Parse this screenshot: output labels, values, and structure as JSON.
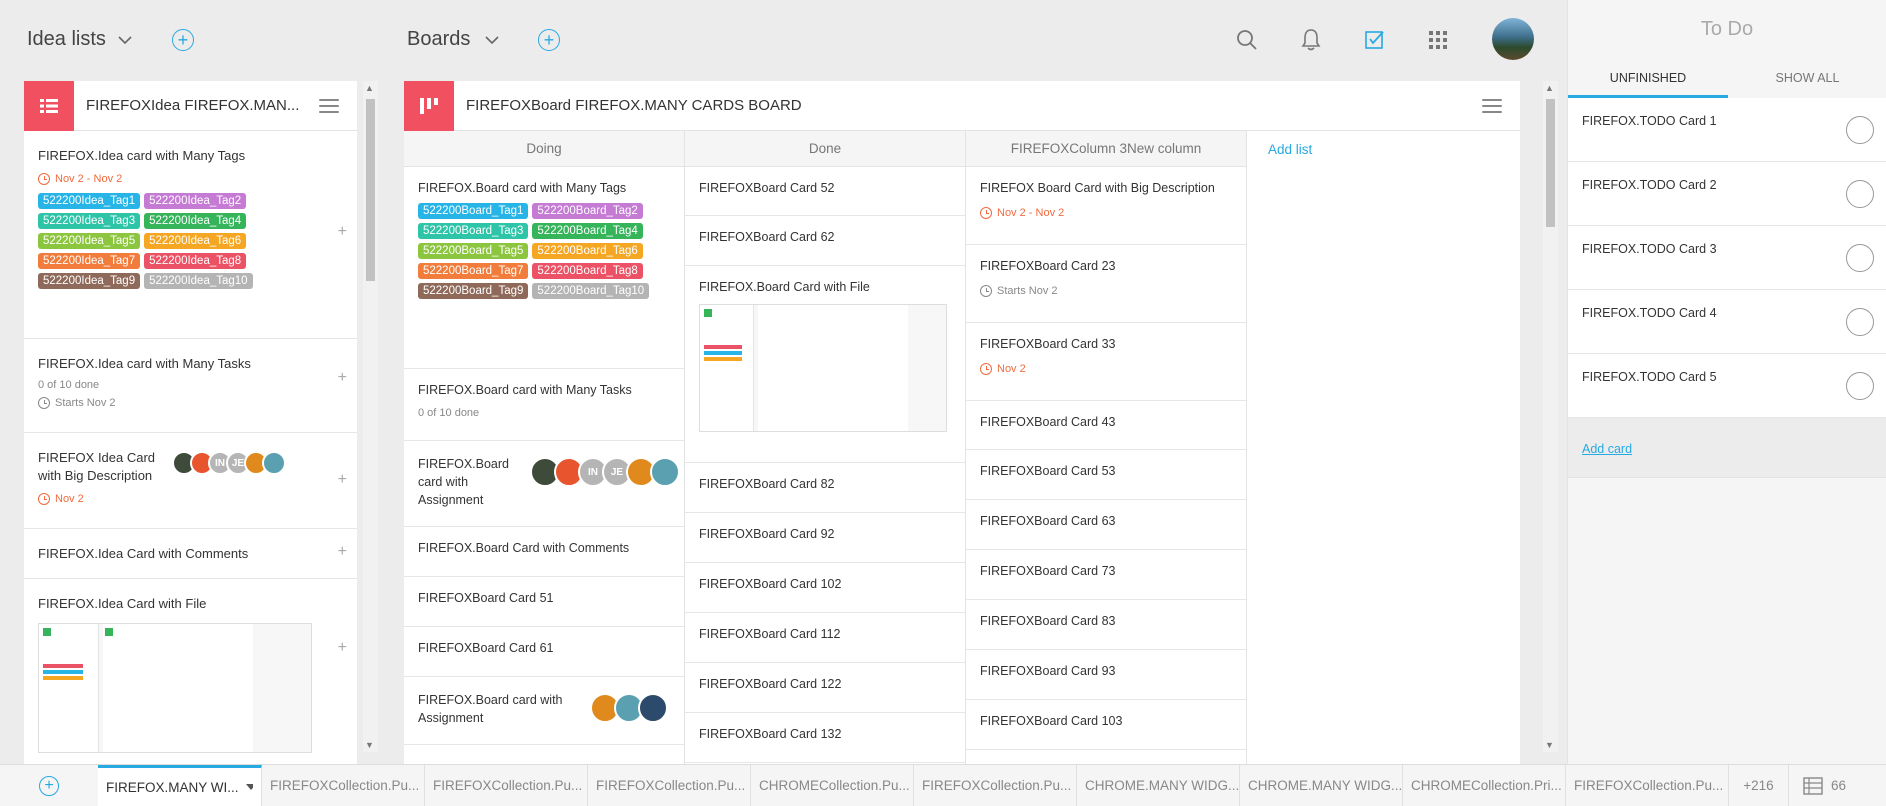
{
  "topbar": {
    "idea_lists_label": "Idea lists",
    "boards_label": "Boards"
  },
  "idea_panel": {
    "title": "FIREFOXIdea FIREFOX.MAN...",
    "cards": [
      {
        "title": "FIREFOX.Idea card with Many Tags",
        "date": "Nov 2 - Nov 2",
        "tags": [
          {
            "label": "522200Idea_Tag1",
            "color": "#27b5e8"
          },
          {
            "label": "522200Idea_Tag2",
            "color": "#c57ad4"
          },
          {
            "label": "522200Idea_Tag3",
            "color": "#2ec4a8"
          },
          {
            "label": "522200Idea_Tag4",
            "color": "#35b45a"
          },
          {
            "label": "522200Idea_Tag5",
            "color": "#8cc63f"
          },
          {
            "label": "522200Idea_Tag6",
            "color": "#f5a623"
          },
          {
            "label": "522200Idea_Tag7",
            "color": "#f27c3b"
          },
          {
            "label": "522200Idea_Tag8",
            "color": "#ec5265"
          },
          {
            "label": "522200Idea_Tag9",
            "color": "#8f6a5b"
          },
          {
            "label": "522200Idea_Tag10",
            "color": "#b4b4b4"
          }
        ]
      },
      {
        "title": "FIREFOX.Idea card with Many Tasks",
        "tasks": "0 of 10 done",
        "date": "Starts Nov 2"
      },
      {
        "title": "FIREFOX Idea Card with Big Description",
        "date": "Nov 2"
      },
      {
        "title": "FIREFOX.Idea Card with Comments"
      },
      {
        "title": "FIREFOX.Idea Card with File"
      }
    ]
  },
  "board_panel": {
    "title": "FIREFOXBoard FIREFOX.MANY CARDS BOARD",
    "add_list": "Add list",
    "columns": [
      {
        "name": "Doing"
      },
      {
        "name": "Done"
      },
      {
        "name": "FIREFOXColumn 3New column"
      }
    ],
    "doing": {
      "card1": "FIREFOX.Board card with Many Tags",
      "tags": [
        {
          "label": "522200Board_Tag1",
          "color": "#27b5e8"
        },
        {
          "label": "522200Board_Tag2",
          "color": "#c57ad4"
        },
        {
          "label": "522200Board_Tag3",
          "color": "#2ec4a8"
        },
        {
          "label": "522200Board_Tag4",
          "color": "#35b45a"
        },
        {
          "label": "522200Board_Tag5",
          "color": "#8cc63f"
        },
        {
          "label": "522200Board_Tag6",
          "color": "#f5a623"
        },
        {
          "label": "522200Board_Tag7",
          "color": "#f27c3b"
        },
        {
          "label": "522200Board_Tag8",
          "color": "#ec5265"
        },
        {
          "label": "522200Board_Tag9",
          "color": "#8f6a5b"
        },
        {
          "label": "522200Board_Tag10",
          "color": "#b4b4b4"
        }
      ],
      "card2": "FIREFOX.Board card with Many Tasks",
      "card2_tasks": "0 of 10 done",
      "card3": "FIREFOX.Board card with Assignment",
      "card4": "FIREFOX.Board Card with Comments",
      "card5": "FIREFOXBoard Card 51",
      "card6": "FIREFOXBoard Card 61",
      "card7": "FIREFOX.Board card with Assignment"
    },
    "done": {
      "c1": "FIREFOXBoard Card 52",
      "c2": "FIREFOXBoard Card 62",
      "c3": "FIREFOX.Board Card with File",
      "c4": "FIREFOXBoard Card 82",
      "c5": "FIREFOXBoard Card 92",
      "c6": "FIREFOXBoard Card 102",
      "c7": "FIREFOXBoard Card 112",
      "c8": "FIREFOXBoard Card 122",
      "c9": "FIREFOXBoard Card 132"
    },
    "col3": {
      "c1": "FIREFOX Board Card with Big Description",
      "c1_date": "Nov 2 - Nov 2",
      "c2": "FIREFOXBoard Card 23",
      "c2_date": "Starts Nov 2",
      "c3": "FIREFOXBoard Card 33",
      "c3_date": "Nov 2",
      "c4": "FIREFOXBoard Card 43",
      "c5": "FIREFOXBoard Card 53",
      "c6": "FIREFOXBoard Card 63",
      "c7": "FIREFOXBoard Card 73",
      "c8": "FIREFOXBoard Card 83",
      "c9": "FIREFOXBoard Card 93",
      "c10": "FIREFOXBoard Card 103"
    }
  },
  "todo_panel": {
    "title": "To Do",
    "tab_unfinished": "UNFINISHED",
    "tab_show_all": "SHOW ALL",
    "items": [
      "FIREFOX.TODO Card 1",
      "FIREFOX.TODO Card 2",
      "FIREFOX.TODO Card 3",
      "FIREFOX.TODO Card 4",
      "FIREFOX.TODO Card 5"
    ],
    "add_card": "Add card"
  },
  "bottom_tabs": {
    "t1": "FIREFOX.MANY WI...",
    "t2": "FIREFOXCollection.Pu...",
    "t3": "FIREFOXCollection.Pu...",
    "t4": "FIREFOXCollection.Pu...",
    "t5": "CHROMECollection.Pu...",
    "t6": "FIREFOXCollection.Pu...",
    "t7": "CHROME.MANY WIDG...",
    "t8": "CHROME.MANY WIDG...",
    "t9": "CHROMECollection.Pri...",
    "t10": "FIREFOXCollection.Pu...",
    "more": "+216",
    "count": "66"
  },
  "colors": {
    "accent": "#27a9e1",
    "badge": "#f05060",
    "date_red": "#f26a3d"
  }
}
